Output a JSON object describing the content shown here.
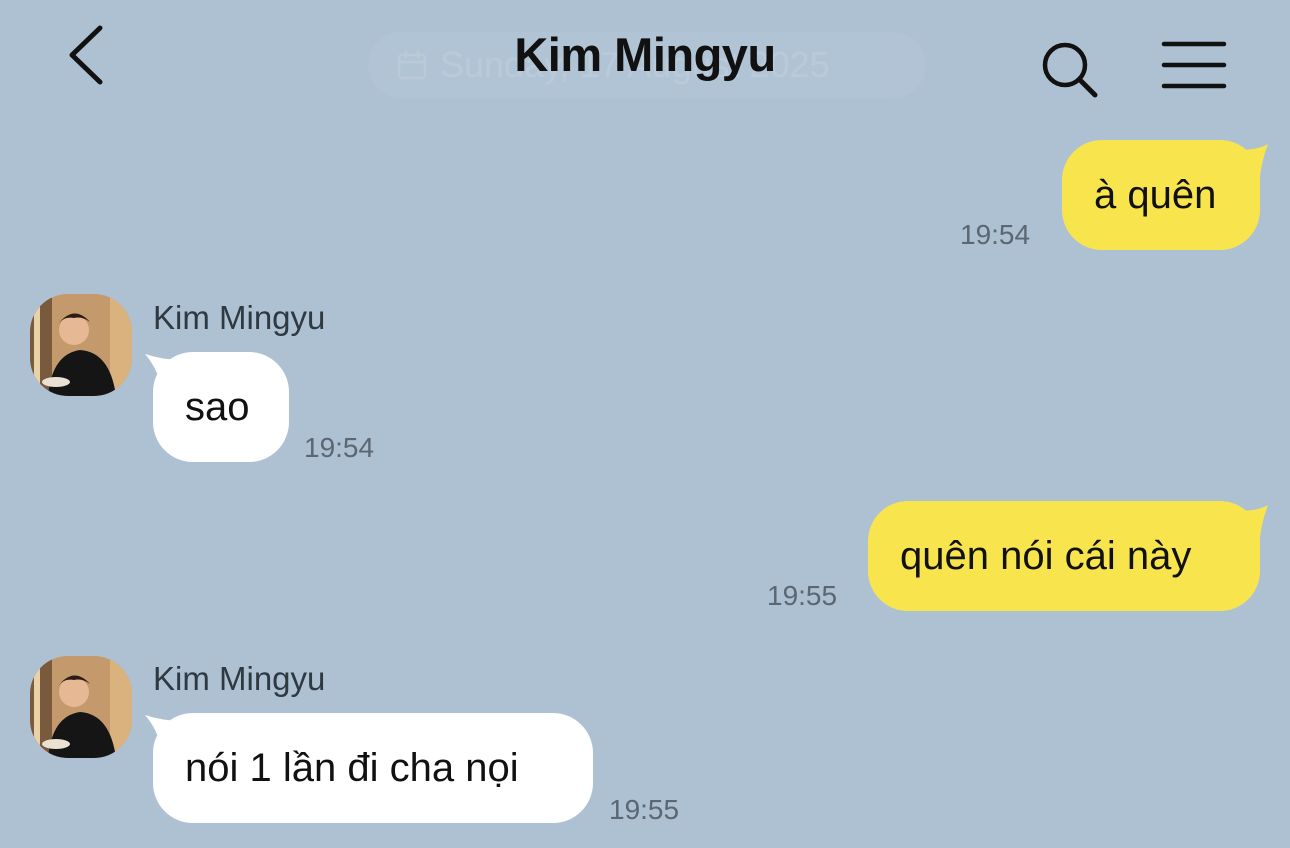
{
  "header": {
    "title": "Kim Mingyu",
    "date_chip": "Sunday, 17 August 2025"
  },
  "icons": {
    "back": "chevron-left-icon",
    "search": "search-icon",
    "menu": "hamburger-menu-icon",
    "calendar": "calendar-icon"
  },
  "colors": {
    "background": "#aec1d3",
    "my_bubble": "#f8e54d",
    "their_bubble": "#ffffff"
  },
  "messages": [
    {
      "from": "me",
      "text": "à quên",
      "time": "19:54"
    },
    {
      "from": "them",
      "sender": "Kim Mingyu",
      "text": "sao",
      "time": "19:54"
    },
    {
      "from": "me",
      "text": "quên nói cái này",
      "time": "19:55"
    },
    {
      "from": "them",
      "sender": "Kim Mingyu",
      "text": "nói 1 lần đi cha nọi",
      "time": "19:55"
    }
  ]
}
